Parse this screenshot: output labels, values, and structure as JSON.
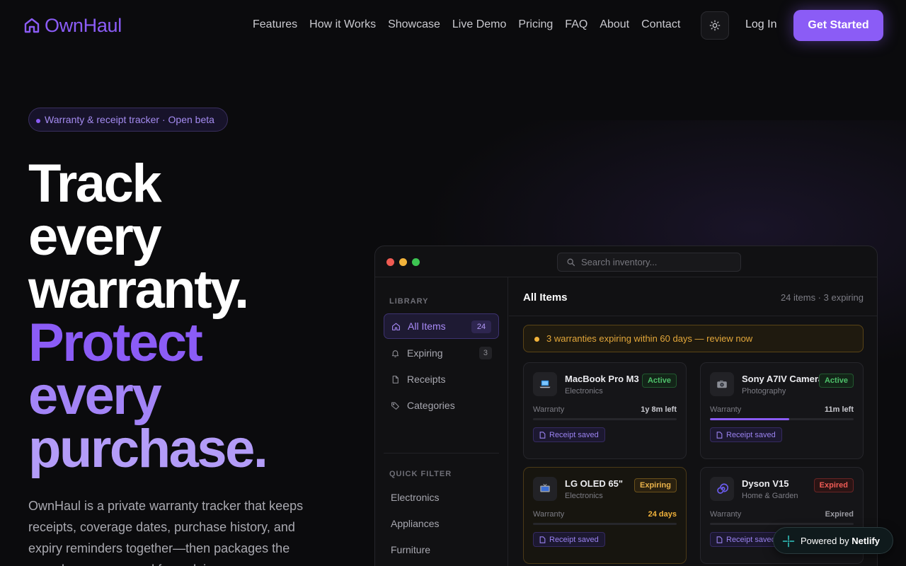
{
  "brand": {
    "name": "OwnHaul",
    "accent": "#8b5cf6"
  },
  "nav": {
    "links": [
      "Features",
      "How it Works",
      "Showcase",
      "Live Demo",
      "Pricing",
      "FAQ",
      "About",
      "Contact"
    ],
    "login": "Log In",
    "cta": "Get Started",
    "theme_icon": "sun-icon"
  },
  "hero": {
    "badge": "Warranty & receipt tracker · Open beta",
    "headline_white": [
      "Track",
      "every",
      "warranty."
    ],
    "headline_purple": [
      "Protect",
      "every",
      "purchase."
    ],
    "subtitle": "OwnHaul is a private warranty tracker that keeps receipts, coverage dates, purchase history, and expiry reminders together—then packages the records you may need for a claim."
  },
  "app": {
    "search_placeholder": "Search inventory...",
    "sidebar": {
      "library_title": "LIBRARY",
      "items": [
        {
          "label": "All Items",
          "count": "24",
          "icon": "home-icon"
        },
        {
          "label": "Expiring",
          "count": "3",
          "icon": "bell-icon"
        },
        {
          "label": "Receipts",
          "icon": "file-icon"
        },
        {
          "label": "Categories",
          "icon": "tag-icon"
        }
      ],
      "filter_title": "QUICK FILTER",
      "filters": [
        "Electronics",
        "Appliances",
        "Furniture"
      ]
    },
    "main": {
      "title": "All Items",
      "meta": "24 items · 3 expiring",
      "alert": "3 warranties expiring within 60 days — review now",
      "warranty_label": "Warranty",
      "receipt_label": "Receipt saved",
      "cards": [
        {
          "name": "MacBook Pro M3",
          "category": "Electronics",
          "status": "Active",
          "remaining": "1y 8m left",
          "progress": 0,
          "icon": "laptop-icon"
        },
        {
          "name": "Sony A7IV Camera",
          "category": "Photography",
          "status": "Active",
          "remaining": "11m left",
          "progress": 0.55,
          "icon": "camera-icon"
        },
        {
          "name": "LG OLED 65\"",
          "category": "Electronics",
          "status": "Expiring",
          "remaining": "24 days",
          "progress": 0,
          "icon": "tv-icon"
        },
        {
          "name": "Dyson V15",
          "category": "Home & Garden",
          "status": "Expired",
          "remaining": "Expired",
          "progress": 0,
          "icon": "vacuum-icon"
        }
      ]
    }
  },
  "netlify": {
    "prefix": "Powered by",
    "brand": "Netlify"
  },
  "colors": {
    "active": "#4ec06a",
    "expiring": "#eab34a",
    "expired": "#ef5b55"
  }
}
